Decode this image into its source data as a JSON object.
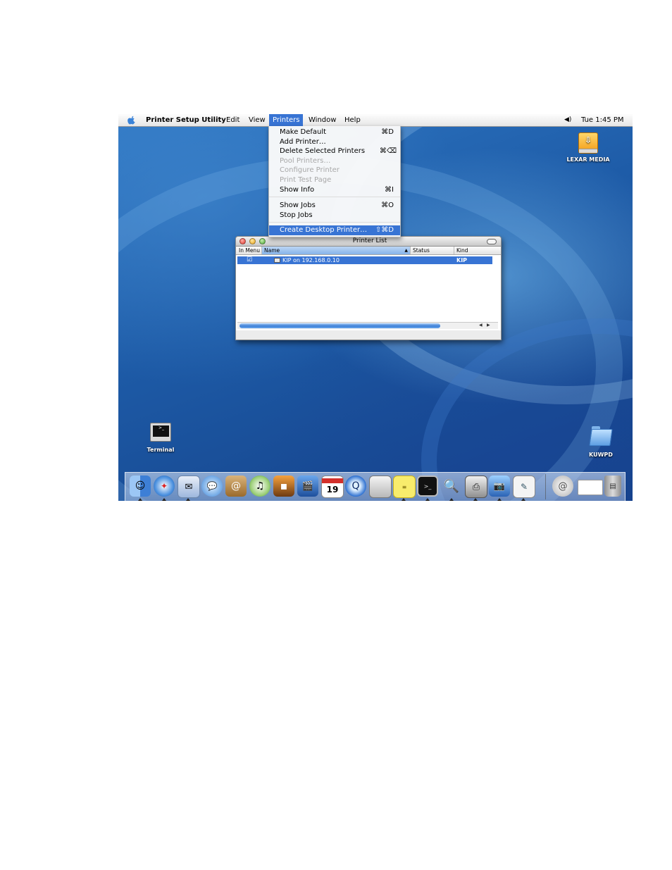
{
  "menubar": {
    "app_name": "Printer Setup Utility",
    "menus": [
      "Edit",
      "View",
      "Printers",
      "Window",
      "Help"
    ],
    "clock": "Tue 1:45 PM",
    "volume_icon": "speaker-icon",
    "apple_icon": "apple-logo-icon"
  },
  "printers_menu": {
    "items": [
      {
        "label": "Make Default",
        "shortcut": "⌘D",
        "enabled": true
      },
      {
        "label": "Add Printer…",
        "shortcut": "",
        "enabled": true
      },
      {
        "label": "Delete Selected Printers",
        "shortcut": "⌘⌫",
        "enabled": true
      },
      {
        "label": "Pool Printers…",
        "shortcut": "",
        "enabled": false
      },
      {
        "label": "Configure Printer",
        "shortcut": "",
        "enabled": false
      },
      {
        "label": "Print Test Page",
        "shortcut": "",
        "enabled": false
      },
      {
        "label": "Show Info",
        "shortcut": "⌘I",
        "enabled": true
      },
      {
        "label": "Show Jobs",
        "shortcut": "⌘O",
        "enabled": true
      },
      {
        "label": "Stop Jobs",
        "shortcut": "",
        "enabled": true
      },
      {
        "label": "Create Desktop Printer…",
        "shortcut": "⇧⌘D",
        "enabled": true,
        "highlighted": true
      }
    ]
  },
  "printer_list": {
    "title": "Printer List",
    "columns": [
      "In Menu",
      "Name",
      "Status",
      "Kind"
    ],
    "rows": [
      {
        "in_menu": "☑",
        "name": "KIP on 192.168.0.10",
        "status": "",
        "kind": "KIP"
      }
    ]
  },
  "desktop": {
    "icons": [
      {
        "label": "LEXAR MEDIA",
        "icon": "usb-drive-icon"
      },
      {
        "label": "Terminal",
        "icon": "terminal-icon"
      },
      {
        "label": "KUWPD",
        "icon": "folder-icon"
      }
    ]
  },
  "dock": {
    "calendar_day": "19",
    "items": [
      "finder-icon",
      "safari-icon",
      "mail-icon",
      "ichat-icon",
      "address-book-icon",
      "itunes-icon",
      "iphoto-icon",
      "imovie-icon",
      "ical-icon",
      "quicktime-icon",
      "system-preferences-icon",
      "stickies-icon",
      "terminal-icon",
      "sherlock-icon",
      "printer-setup-icon",
      "image-capture-icon",
      "preview-icon",
      "mail-drop-icon",
      "window-icon",
      "trash-icon"
    ]
  }
}
